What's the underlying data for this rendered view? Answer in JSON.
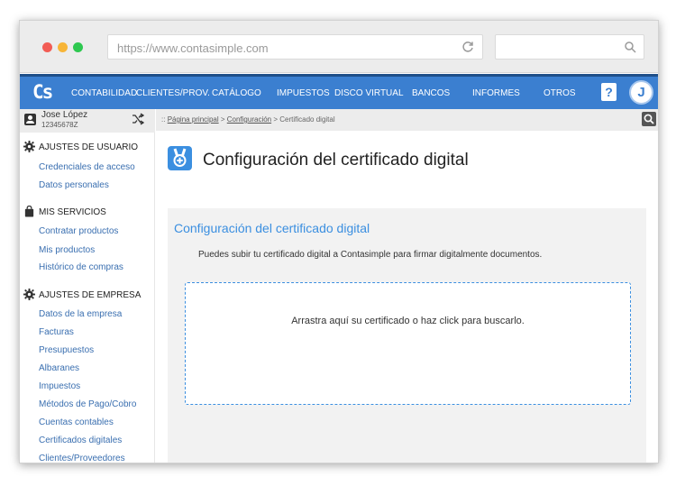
{
  "browser": {
    "url": "https://www.contasimple.com",
    "search_placeholder": ""
  },
  "app": {
    "logo": "Cs",
    "nav": [
      "CONTABILIDAD",
      "CLIENTES/PROV.",
      "CATÁLOGO",
      "IMPUESTOS",
      "DISCO VIRTUAL",
      "BANCOS",
      "INFORMES",
      "OTROS"
    ],
    "help_label": "?",
    "avatar_initial": "J",
    "accent_color": "#3b7fd0"
  },
  "sidebar": {
    "user_name": "Jose López",
    "user_id": "12345678Z",
    "sections": [
      {
        "title": "AJUSTES DE USUARIO",
        "icon": "gear-icon",
        "items": [
          "Credenciales de acceso",
          "Datos personales"
        ]
      },
      {
        "title": "MIS SERVICIOS",
        "icon": "bag-icon",
        "items": [
          "Contratar productos",
          "Mis productos",
          "Histórico de compras"
        ]
      },
      {
        "title": "AJUSTES DE EMPRESA",
        "icon": "gear-icon",
        "items": [
          "Datos de la empresa",
          "Facturas",
          "Presupuestos",
          "Albaranes",
          "Impuestos",
          "Métodos de Pago/Cobro",
          "Cuentas contables",
          "Certificados digitales",
          "Clientes/Proveedores"
        ]
      }
    ]
  },
  "breadcrumb": {
    "prefix": "::",
    "items": [
      "Página principal",
      "Configuración",
      "Certificado digital"
    ]
  },
  "main": {
    "page_title": "Configuración del certificado digital",
    "card_title": "Configuración del certificado digital",
    "card_text": "Puedes subir tu certificado digital a Contasimple para firmar digitalmente documentos.",
    "dropzone_text": "Arrastra aquí su certificado o haz click para buscarlo."
  }
}
